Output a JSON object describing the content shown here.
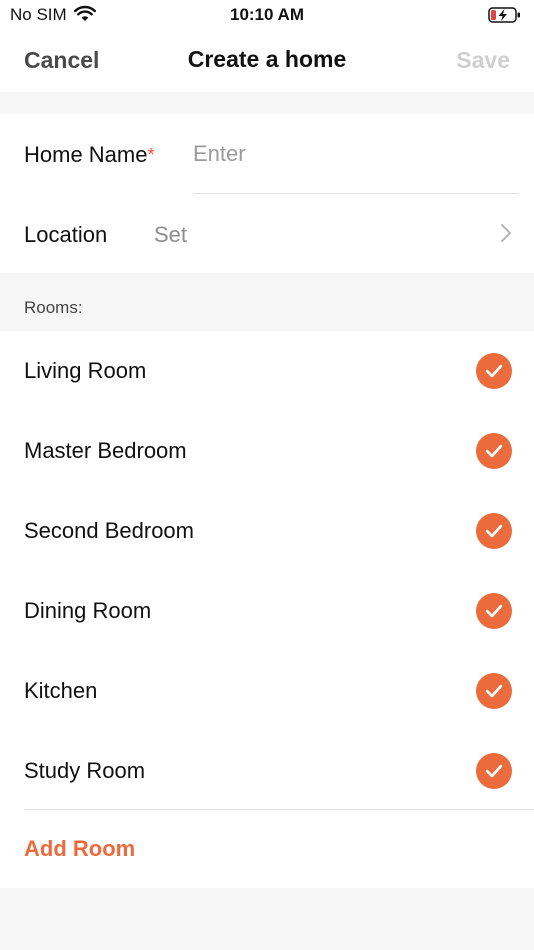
{
  "status_bar": {
    "carrier": "No SIM",
    "time": "10:10 AM",
    "wifi_icon": "wifi-icon",
    "battery_icon": "battery-charging-icon"
  },
  "nav": {
    "cancel_label": "Cancel",
    "title": "Create a home",
    "save_label": "Save"
  },
  "form": {
    "home_name_label": "Home Name",
    "required_mark": "*",
    "home_name_value": "",
    "home_name_placeholder": "Enter",
    "location_label": "Location",
    "location_value": "Set",
    "chevron_icon": "chevron-right-icon"
  },
  "rooms": {
    "header": "Rooms:",
    "items": [
      {
        "label": "Living Room",
        "checked": true
      },
      {
        "label": "Master Bedroom",
        "checked": true
      },
      {
        "label": "Second Bedroom",
        "checked": true
      },
      {
        "label": "Dining Room",
        "checked": true
      },
      {
        "label": "Kitchen",
        "checked": true
      },
      {
        "label": "Study Room",
        "checked": true
      }
    ],
    "add_label": "Add Room"
  },
  "colors": {
    "accent": "#ec6b3d",
    "required": "#f04a2a",
    "disabled": "#cfcfcf",
    "background": "#f6f6f6"
  }
}
